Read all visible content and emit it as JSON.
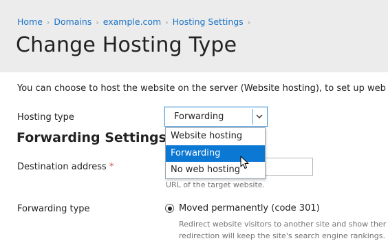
{
  "breadcrumb": {
    "items": [
      "Home",
      "Domains",
      "example.com",
      "Hosting Settings"
    ]
  },
  "page": {
    "title": "Change Hosting Type",
    "intro": "You can choose to host the website on the server (Website hosting), to set up web f"
  },
  "hosting_type": {
    "label": "Hosting type",
    "selected": "Forwarding",
    "options": [
      "Website hosting",
      "Forwarding",
      "No web hosting"
    ],
    "highlighted_index": 1
  },
  "forwarding": {
    "section_title": "Forwarding Settings",
    "destination_label": "Destination address",
    "required_mark": "*",
    "destination_value": "",
    "destination_hint": "URL of the target website.",
    "type_label": "Forwarding type",
    "type_selected": "Moved permanently (code 301)",
    "type_desc_line1": "Redirect website visitors to another site and show ther",
    "type_desc_line2": "redirection will keep the site's search engine rankings."
  },
  "colors": {
    "link": "#1a73c6",
    "header_bg": "#ececec",
    "selected_option_bg": "#0b78d4",
    "required": "#d9534f"
  },
  "icons": {
    "breadcrumb_separator": "chevron-right-icon",
    "select_toggle": "chevron-down-icon",
    "pointer": "mouse-cursor-icon"
  }
}
